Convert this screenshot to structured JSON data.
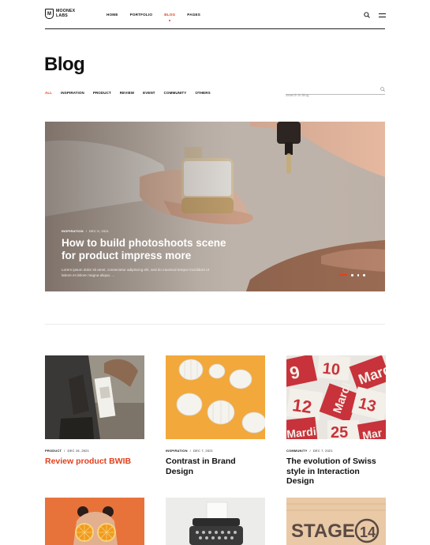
{
  "brand": {
    "mark": "M",
    "line1": "MOONEX",
    "line2": "LABS"
  },
  "nav": [
    {
      "label": "HOME",
      "active": false
    },
    {
      "label": "PORTFOLIO",
      "active": false
    },
    {
      "label": "BLOG",
      "active": true
    },
    {
      "label": "PAGES",
      "active": false
    }
  ],
  "page_title": "Blog",
  "filters": [
    "ALL",
    "INSPIRATION",
    "PRODUCT",
    "REVIEW",
    "EVENT",
    "COMMUNITY",
    "OTHERS"
  ],
  "active_filter": "ALL",
  "search": {
    "placeholder": "Search in blog",
    "value": ""
  },
  "hero": {
    "category": "INSPIRATION",
    "date": "DEC 5, 2021",
    "title": "How to build photoshoots scene for product impress more",
    "excerpt": "Lorem ipsum dolor sit amet, consectetur adipiscing elit, sed do eiusmod tempor incididunt ut labore et dolore magna aliqua. ...",
    "slide_count": 4,
    "active_slide": 1
  },
  "posts": [
    {
      "category": "PRODUCT",
      "date": "DEC 15, 2021",
      "title": "Review product BWIB",
      "highlight": true
    },
    {
      "category": "INSPIRATION",
      "date": "DEC 7, 2021",
      "title": "Contrast in Brand Design",
      "highlight": false
    },
    {
      "category": "COMMUNITY",
      "date": "DEC 7, 2021",
      "title": "The evolution of Swiss style in Interaction Design",
      "highlight": false
    }
  ],
  "colors": {
    "accent": "#e2401c",
    "text": "#111111",
    "orange": "#f2a83b",
    "red": "#c8323a"
  },
  "icons": {
    "search": "search-icon",
    "menu": "menu-icon"
  }
}
